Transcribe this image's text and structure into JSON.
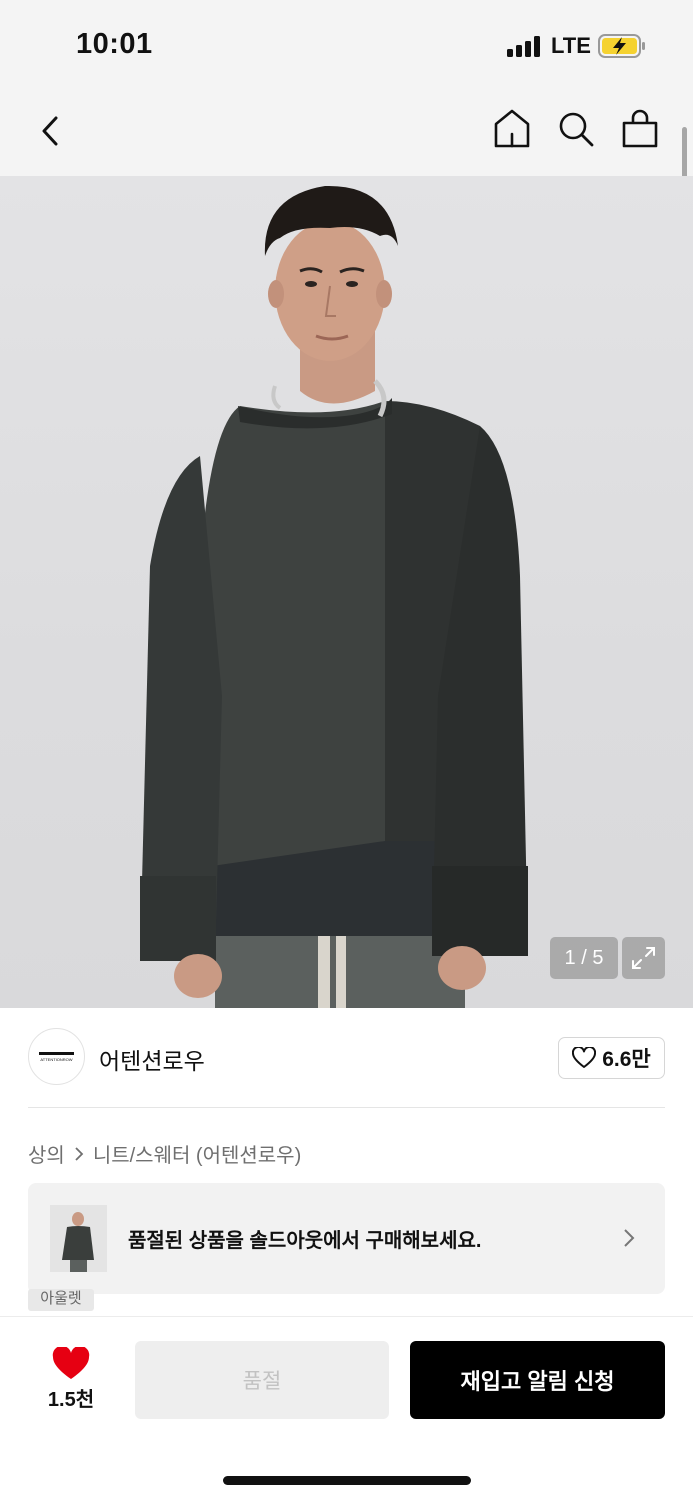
{
  "status_bar": {
    "time": "10:01",
    "network": "LTE",
    "battery_state": "charging"
  },
  "nav": {
    "back_icon": "chevron-left-icon",
    "home_icon": "home-icon",
    "search_icon": "search-icon",
    "bag_icon": "shopping-bag-icon"
  },
  "gallery": {
    "counter": "1 / 5",
    "expand_icon": "expand-icon"
  },
  "brand": {
    "logo_text": "ATTENTIONROW",
    "name": "어텐션로우",
    "like_count": "6.6만"
  },
  "breadcrumb": {
    "category": "상의",
    "subcategory": "니트/스웨터 (어텐션로우)"
  },
  "soldout_banner": {
    "text": "품절된 상품을 솔드아웃에서 구매해보세요.",
    "tag": "아울렛"
  },
  "bottom_bar": {
    "wish_count": "1.5천",
    "soldout_label": "품절",
    "restock_label": "재입고 알림 신청"
  },
  "colors": {
    "accent_red": "#e60012",
    "primary_button": "#000000",
    "disabled_button": "#eeeeee"
  }
}
